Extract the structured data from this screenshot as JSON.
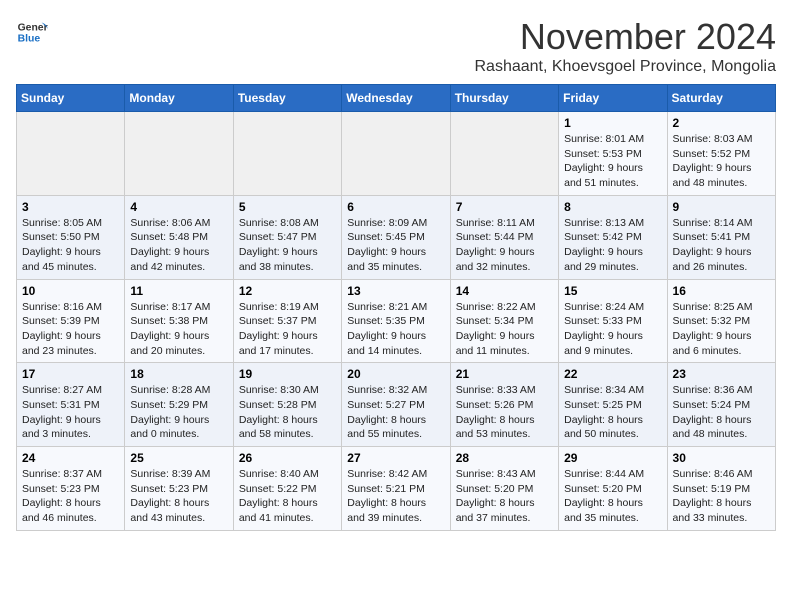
{
  "logo": {
    "line1": "General",
    "line2": "Blue"
  },
  "title": "November 2024",
  "location": "Rashaant, Khoevsgoel Province, Mongolia",
  "weekdays": [
    "Sunday",
    "Monday",
    "Tuesday",
    "Wednesday",
    "Thursday",
    "Friday",
    "Saturday"
  ],
  "weeks": [
    [
      {
        "day": "",
        "info": ""
      },
      {
        "day": "",
        "info": ""
      },
      {
        "day": "",
        "info": ""
      },
      {
        "day": "",
        "info": ""
      },
      {
        "day": "",
        "info": ""
      },
      {
        "day": "1",
        "info": "Sunrise: 8:01 AM\nSunset: 5:53 PM\nDaylight: 9 hours\nand 51 minutes."
      },
      {
        "day": "2",
        "info": "Sunrise: 8:03 AM\nSunset: 5:52 PM\nDaylight: 9 hours\nand 48 minutes."
      }
    ],
    [
      {
        "day": "3",
        "info": "Sunrise: 8:05 AM\nSunset: 5:50 PM\nDaylight: 9 hours\nand 45 minutes."
      },
      {
        "day": "4",
        "info": "Sunrise: 8:06 AM\nSunset: 5:48 PM\nDaylight: 9 hours\nand 42 minutes."
      },
      {
        "day": "5",
        "info": "Sunrise: 8:08 AM\nSunset: 5:47 PM\nDaylight: 9 hours\nand 38 minutes."
      },
      {
        "day": "6",
        "info": "Sunrise: 8:09 AM\nSunset: 5:45 PM\nDaylight: 9 hours\nand 35 minutes."
      },
      {
        "day": "7",
        "info": "Sunrise: 8:11 AM\nSunset: 5:44 PM\nDaylight: 9 hours\nand 32 minutes."
      },
      {
        "day": "8",
        "info": "Sunrise: 8:13 AM\nSunset: 5:42 PM\nDaylight: 9 hours\nand 29 minutes."
      },
      {
        "day": "9",
        "info": "Sunrise: 8:14 AM\nSunset: 5:41 PM\nDaylight: 9 hours\nand 26 minutes."
      }
    ],
    [
      {
        "day": "10",
        "info": "Sunrise: 8:16 AM\nSunset: 5:39 PM\nDaylight: 9 hours\nand 23 minutes."
      },
      {
        "day": "11",
        "info": "Sunrise: 8:17 AM\nSunset: 5:38 PM\nDaylight: 9 hours\nand 20 minutes."
      },
      {
        "day": "12",
        "info": "Sunrise: 8:19 AM\nSunset: 5:37 PM\nDaylight: 9 hours\nand 17 minutes."
      },
      {
        "day": "13",
        "info": "Sunrise: 8:21 AM\nSunset: 5:35 PM\nDaylight: 9 hours\nand 14 minutes."
      },
      {
        "day": "14",
        "info": "Sunrise: 8:22 AM\nSunset: 5:34 PM\nDaylight: 9 hours\nand 11 minutes."
      },
      {
        "day": "15",
        "info": "Sunrise: 8:24 AM\nSunset: 5:33 PM\nDaylight: 9 hours\nand 9 minutes."
      },
      {
        "day": "16",
        "info": "Sunrise: 8:25 AM\nSunset: 5:32 PM\nDaylight: 9 hours\nand 6 minutes."
      }
    ],
    [
      {
        "day": "17",
        "info": "Sunrise: 8:27 AM\nSunset: 5:31 PM\nDaylight: 9 hours\nand 3 minutes."
      },
      {
        "day": "18",
        "info": "Sunrise: 8:28 AM\nSunset: 5:29 PM\nDaylight: 9 hours\nand 0 minutes."
      },
      {
        "day": "19",
        "info": "Sunrise: 8:30 AM\nSunset: 5:28 PM\nDaylight: 8 hours\nand 58 minutes."
      },
      {
        "day": "20",
        "info": "Sunrise: 8:32 AM\nSunset: 5:27 PM\nDaylight: 8 hours\nand 55 minutes."
      },
      {
        "day": "21",
        "info": "Sunrise: 8:33 AM\nSunset: 5:26 PM\nDaylight: 8 hours\nand 53 minutes."
      },
      {
        "day": "22",
        "info": "Sunrise: 8:34 AM\nSunset: 5:25 PM\nDaylight: 8 hours\nand 50 minutes."
      },
      {
        "day": "23",
        "info": "Sunrise: 8:36 AM\nSunset: 5:24 PM\nDaylight: 8 hours\nand 48 minutes."
      }
    ],
    [
      {
        "day": "24",
        "info": "Sunrise: 8:37 AM\nSunset: 5:23 PM\nDaylight: 8 hours\nand 46 minutes."
      },
      {
        "day": "25",
        "info": "Sunrise: 8:39 AM\nSunset: 5:23 PM\nDaylight: 8 hours\nand 43 minutes."
      },
      {
        "day": "26",
        "info": "Sunrise: 8:40 AM\nSunset: 5:22 PM\nDaylight: 8 hours\nand 41 minutes."
      },
      {
        "day": "27",
        "info": "Sunrise: 8:42 AM\nSunset: 5:21 PM\nDaylight: 8 hours\nand 39 minutes."
      },
      {
        "day": "28",
        "info": "Sunrise: 8:43 AM\nSunset: 5:20 PM\nDaylight: 8 hours\nand 37 minutes."
      },
      {
        "day": "29",
        "info": "Sunrise: 8:44 AM\nSunset: 5:20 PM\nDaylight: 8 hours\nand 35 minutes."
      },
      {
        "day": "30",
        "info": "Sunrise: 8:46 AM\nSunset: 5:19 PM\nDaylight: 8 hours\nand 33 minutes."
      }
    ]
  ]
}
